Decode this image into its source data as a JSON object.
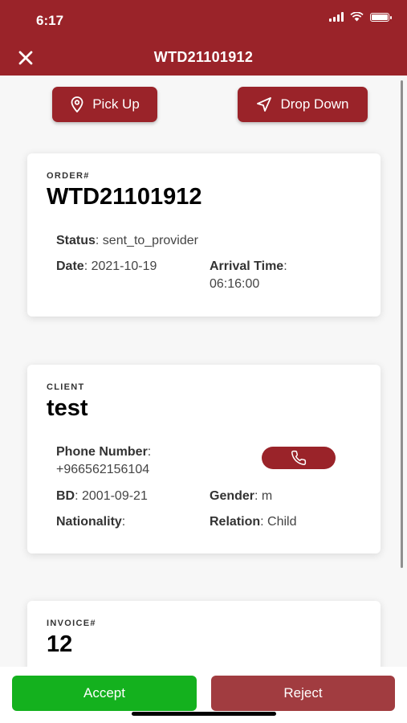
{
  "status_bar": {
    "time": "6:17"
  },
  "header": {
    "title": "WTD21101912",
    "close_icon": "close-icon"
  },
  "location_buttons": {
    "pickup": {
      "label": "Pick Up",
      "icon": "map-pin-icon"
    },
    "dropdown": {
      "label": "Drop Down",
      "icon": "navigation-arrow-icon"
    }
  },
  "order": {
    "label": "ORDER#",
    "number": "WTD21101912",
    "status_label": "Status",
    "status_value": "sent_to_provider",
    "date_label": "Date",
    "date_value": "2021-10-19",
    "arrival_label": "Arrival Time",
    "arrival_value": "06:16:00"
  },
  "client": {
    "label": "CLIENT",
    "name": "test",
    "phone_label": "Phone Number",
    "phone_value": "+966562156104",
    "bd_label": "BD",
    "bd_value": "2001-09-21",
    "gender_label": "Gender",
    "gender_value": "m",
    "nationality_label": "Nationality",
    "nationality_value": "",
    "relation_label": "Relation",
    "relation_value": "Child",
    "call_icon": "phone-icon"
  },
  "invoice": {
    "label": "INVOICE#",
    "number": "12"
  },
  "actions": {
    "accept": "Accept",
    "reject": "Reject"
  },
  "colors": {
    "primary": "#9a2329",
    "accept": "#14b11e",
    "reject": "#a13c40"
  }
}
